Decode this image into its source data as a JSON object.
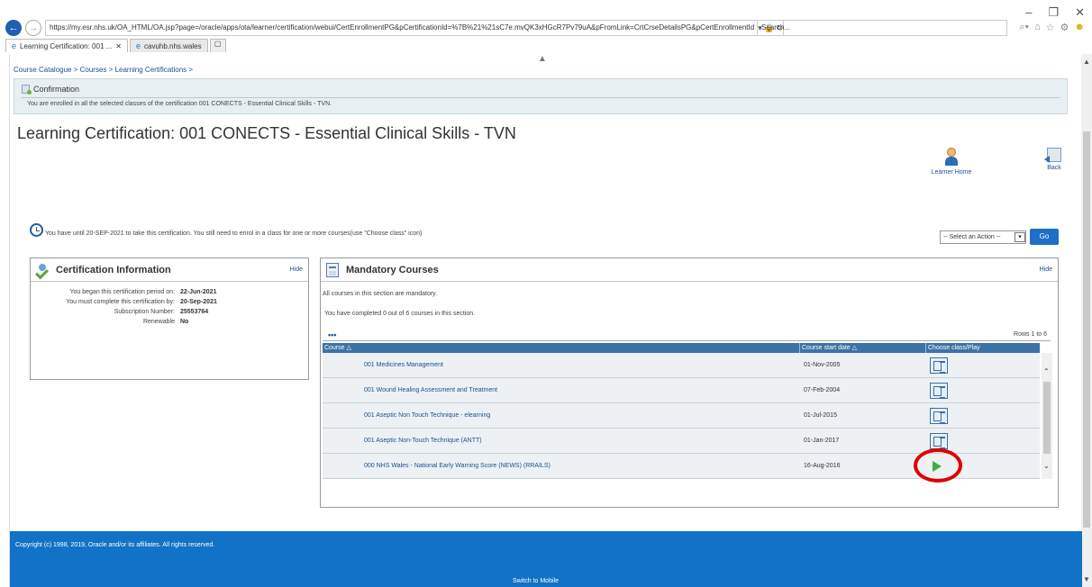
{
  "browser": {
    "url": "https://my.esr.nhs.uk/OA_HTML/OA.jsp?page=/oracle/apps/ota/learner/certification/webui/CertEnrollmentPG&pCertificationId=%7B%21%21sC7e.mvQK3xHGcR7Pv79uA&pFromLink=CrtCrseDetailsPG&pCertEnrollmentId",
    "search_placeholder": "Search...",
    "tabs": [
      {
        "label": "Learning Certification: 001 ..."
      },
      {
        "label": "cavuhb.nhs.wales"
      }
    ],
    "window_controls": [
      "–",
      "❐",
      "✕"
    ]
  },
  "breadcrumb": {
    "items": [
      "Course Catalogue",
      "Courses",
      "Learning Certifications"
    ],
    "separator": ">"
  },
  "confirmation": {
    "title": "Confirmation",
    "message": "You are enrolled in all the selected classes of the certification 001 CONECTS - Essential Clinical Skills - TVN."
  },
  "page_title": "Learning Certification: 001 CONECTS - Essential Clinical Skills - TVN",
  "header_links": {
    "learner_home": "Learner Home",
    "back": "Back"
  },
  "deadline_message": "You have until 20-SEP-2021 to take this certification. You still need to enrol in a class for one or more courses(use \"Choose class\" icon)",
  "action": {
    "select_value": "-- Select an Action --",
    "go_label": "Go"
  },
  "cert_info": {
    "title": "Certification Information",
    "hide_label": "Hide",
    "rows": [
      {
        "label": "You began this certification period on:",
        "value": "22-Jun-2021"
      },
      {
        "label": "You must complete this certification by:",
        "value": "20-Sep-2021"
      },
      {
        "label": "Subscription Number:",
        "value": "25553764"
      },
      {
        "label": "Renewable",
        "value": "No"
      }
    ]
  },
  "mandatory": {
    "title": "Mandatory Courses",
    "hide_label": "Hide",
    "note1": "All courses in this section are mandatory.",
    "note2": "You have completed 0 out of 6 courses in this section.",
    "more": "•••",
    "rows_label": "Rows 1 to 6",
    "columns": [
      "Course",
      "Course start date",
      "Choose class/Play"
    ],
    "sort_glyph": "△",
    "rows": [
      {
        "course": "001 Medicines Management",
        "start": "01-Nov-2005",
        "action": "choose-class"
      },
      {
        "course": "001 Wound Healing Assessment and Treatment",
        "start": "07-Feb-2004",
        "action": "choose-class"
      },
      {
        "course": "001 Aseptic Non Touch Technique - elearning",
        "start": "01-Jul-2015",
        "action": "choose-class"
      },
      {
        "course": "001 Aseptic Non-Touch Technique (ANTT)",
        "start": "01-Jan-2017",
        "action": "choose-class"
      },
      {
        "course": "000 NHS Wales - National Early Warning Score (NEWS) (RRAILS)",
        "start": "16-Aug-2016",
        "action": "play"
      }
    ]
  },
  "footer": {
    "copyright": "Copyright (c) 1998, 2019, Oracle and/or its affiliates. All rights reserved.",
    "switch_mobile": "Switch to Mobile"
  },
  "colors": {
    "footer_bg": "#1172c8",
    "table_header": "#3d72a7",
    "link": "#1e4f8f",
    "highlight_ring": "#e00000",
    "play_green": "#3fae3f"
  }
}
